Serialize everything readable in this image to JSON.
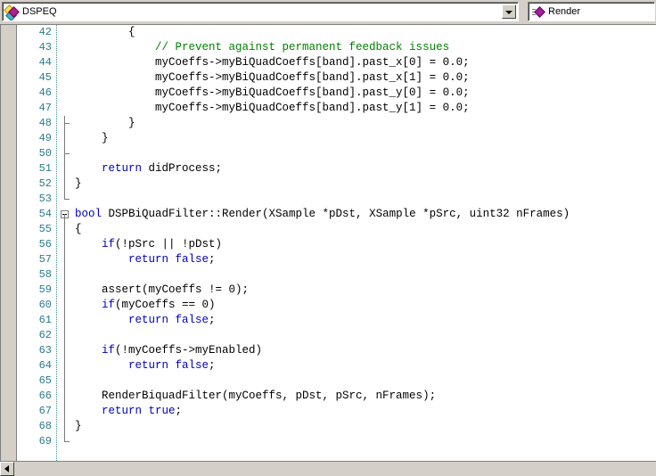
{
  "toolbar": {
    "class_combo": {
      "value": "DSPEQ",
      "icon": "class-diamond-icon",
      "dropdown_icon": "chevron-down-icon"
    },
    "member_combo": {
      "value": "Render",
      "icon": "method-diamond-icon"
    }
  },
  "colors": {
    "keyword": "#0000c0",
    "comment": "#008000",
    "linenumber": "#2b7a8c",
    "chrome": "#d4d0c8",
    "text": "#000000"
  },
  "editor": {
    "first_line": 42,
    "last_line": 69,
    "lines": [
      {
        "n": "42",
        "fold": "none",
        "tokens": [
          {
            "t": "        {",
            "c": ""
          }
        ]
      },
      {
        "n": "43",
        "fold": "none",
        "tokens": [
          {
            "t": "            // Prevent against permanent feedback issues",
            "c": "cmt"
          }
        ]
      },
      {
        "n": "44",
        "fold": "none",
        "tokens": [
          {
            "t": "            myCoeffs->myBiQuadCoeffs[band].past_x[0] = 0.0;",
            "c": ""
          }
        ]
      },
      {
        "n": "45",
        "fold": "none",
        "tokens": [
          {
            "t": "            myCoeffs->myBiQuadCoeffs[band].past_x[1] = 0.0;",
            "c": ""
          }
        ]
      },
      {
        "n": "46",
        "fold": "none",
        "tokens": [
          {
            "t": "            myCoeffs->myBiQuadCoeffs[band].past_y[0] = 0.0;",
            "c": ""
          }
        ]
      },
      {
        "n": "47",
        "fold": "none",
        "tokens": [
          {
            "t": "            myCoeffs->myBiQuadCoeffs[band].past_y[1] = 0.0;",
            "c": ""
          }
        ]
      },
      {
        "n": "48",
        "fold": "endmark",
        "tokens": [
          {
            "t": "        }",
            "c": ""
          }
        ]
      },
      {
        "n": "49",
        "fold": "line",
        "tokens": [
          {
            "t": "    }",
            "c": ""
          }
        ]
      },
      {
        "n": "50",
        "fold": "endmark",
        "tokens": [
          {
            "t": "",
            "c": ""
          }
        ]
      },
      {
        "n": "51",
        "fold": "line",
        "tokens": [
          {
            "t": "    ",
            "c": ""
          },
          {
            "t": "return",
            "c": "kw"
          },
          {
            "t": " didProcess;",
            "c": ""
          }
        ]
      },
      {
        "n": "52",
        "fold": "line",
        "tokens": [
          {
            "t": "}",
            "c": ""
          }
        ]
      },
      {
        "n": "53",
        "fold": "lineend",
        "tokens": [
          {
            "t": "",
            "c": ""
          }
        ]
      },
      {
        "n": "54",
        "fold": "box",
        "tokens": [
          {
            "t": "bool",
            "c": "kw"
          },
          {
            "t": " DSPBiQuadFilter::Render(XSample *pDst, XSample *pSrc, uint32 nFrames)",
            "c": ""
          }
        ]
      },
      {
        "n": "55",
        "fold": "line",
        "tokens": [
          {
            "t": "{",
            "c": ""
          }
        ]
      },
      {
        "n": "56",
        "fold": "line",
        "tokens": [
          {
            "t": "    ",
            "c": ""
          },
          {
            "t": "if",
            "c": "kw"
          },
          {
            "t": "(!pSrc || !pDst)",
            "c": ""
          }
        ]
      },
      {
        "n": "57",
        "fold": "line",
        "tokens": [
          {
            "t": "        ",
            "c": ""
          },
          {
            "t": "return false",
            "c": "kw"
          },
          {
            "t": ";",
            "c": ""
          }
        ]
      },
      {
        "n": "58",
        "fold": "line",
        "tokens": [
          {
            "t": "",
            "c": ""
          }
        ]
      },
      {
        "n": "59",
        "fold": "line",
        "tokens": [
          {
            "t": "    assert(myCoeffs != 0);",
            "c": ""
          }
        ]
      },
      {
        "n": "60",
        "fold": "line",
        "tokens": [
          {
            "t": "    ",
            "c": ""
          },
          {
            "t": "if",
            "c": "kw"
          },
          {
            "t": "(myCoeffs == 0)",
            "c": ""
          }
        ]
      },
      {
        "n": "61",
        "fold": "line",
        "tokens": [
          {
            "t": "        ",
            "c": ""
          },
          {
            "t": "return false",
            "c": "kw"
          },
          {
            "t": ";",
            "c": ""
          }
        ]
      },
      {
        "n": "62",
        "fold": "line",
        "tokens": [
          {
            "t": "",
            "c": ""
          }
        ]
      },
      {
        "n": "63",
        "fold": "line",
        "tokens": [
          {
            "t": "    ",
            "c": ""
          },
          {
            "t": "if",
            "c": "kw"
          },
          {
            "t": "(!myCoeffs->myEnabled)",
            "c": ""
          }
        ]
      },
      {
        "n": "64",
        "fold": "line",
        "tokens": [
          {
            "t": "        ",
            "c": ""
          },
          {
            "t": "return false",
            "c": "kw"
          },
          {
            "t": ";",
            "c": ""
          }
        ]
      },
      {
        "n": "65",
        "fold": "line",
        "tokens": [
          {
            "t": "",
            "c": ""
          }
        ]
      },
      {
        "n": "66",
        "fold": "line",
        "tokens": [
          {
            "t": "    RenderBiquadFilter(myCoeffs, pDst, pSrc, nFrames);",
            "c": ""
          }
        ]
      },
      {
        "n": "67",
        "fold": "line",
        "tokens": [
          {
            "t": "    ",
            "c": ""
          },
          {
            "t": "return true",
            "c": "kw"
          },
          {
            "t": ";",
            "c": ""
          }
        ]
      },
      {
        "n": "68",
        "fold": "line",
        "tokens": [
          {
            "t": "}",
            "c": ""
          }
        ]
      },
      {
        "n": "69",
        "fold": "lineend",
        "tokens": [
          {
            "t": "",
            "c": ""
          }
        ]
      }
    ]
  },
  "scrollbar": {
    "left_arrow_icon": "arrow-left-icon",
    "orientation": "horizontal"
  }
}
